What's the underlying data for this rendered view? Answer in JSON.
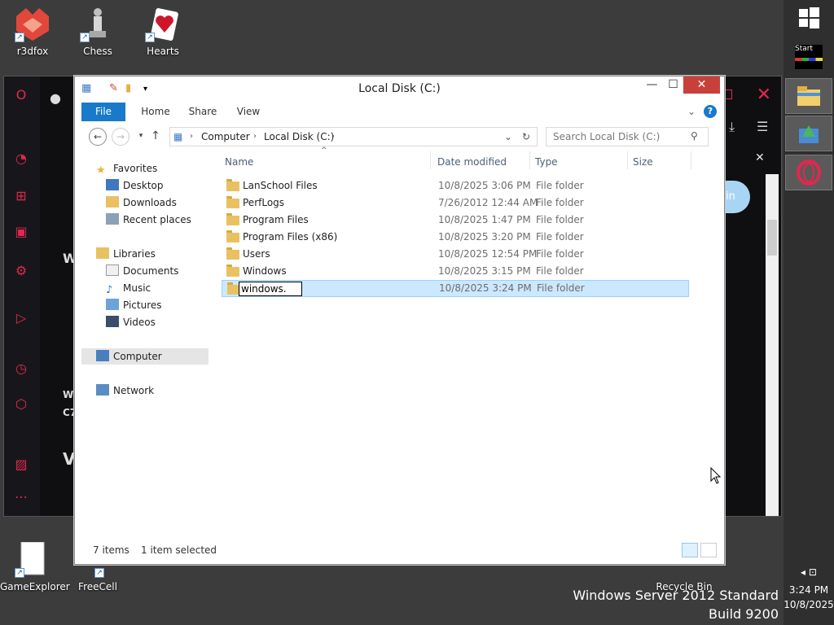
{
  "desktop": {
    "icons_top": [
      {
        "label": "r3dfox"
      },
      {
        "label": "Chess"
      },
      {
        "label": "Hearts"
      }
    ],
    "icons_bottom": [
      {
        "label": "GameExplorer"
      },
      {
        "label": "FreeCell"
      },
      {
        "label": "Recycle Bin"
      }
    ],
    "watermark": {
      "line1": "Windows Server 2012 Standard",
      "line2": "Build 9200"
    }
  },
  "taskbar": {
    "start_label": "Start",
    "clock_time": "3:24 PM",
    "clock_date": "10/8/2025"
  },
  "browser": {
    "partial_text": [
      "W",
      "Wi",
      "C7",
      "V",
      "in"
    ]
  },
  "explorer": {
    "title": "Local Disk (C:)",
    "ribbon_tabs": [
      "File",
      "Home",
      "Share",
      "View"
    ],
    "address_parts": [
      "Computer",
      "Local Disk (C:)"
    ],
    "search_placeholder": "Search Local Disk (C:)",
    "nav": {
      "favorites": "Favorites",
      "desktop": "Desktop",
      "downloads": "Downloads",
      "recent": "Recent places",
      "libraries": "Libraries",
      "documents": "Documents",
      "music": "Music",
      "pictures": "Pictures",
      "videos": "Videos",
      "computer": "Computer",
      "network": "Network"
    },
    "columns": {
      "name": "Name",
      "date": "Date modified",
      "type": "Type",
      "size": "Size"
    },
    "rows": [
      {
        "name": "LanSchool Files",
        "date": "10/8/2025 3:06 PM",
        "type": "File folder"
      },
      {
        "name": "PerfLogs",
        "date": "7/26/2012 12:44 AM",
        "type": "File folder"
      },
      {
        "name": "Program Files",
        "date": "10/8/2025 1:47 PM",
        "type": "File folder"
      },
      {
        "name": "Program Files (x86)",
        "date": "10/8/2025 3:20 PM",
        "type": "File folder"
      },
      {
        "name": "Users",
        "date": "10/8/2025 12:54 PM",
        "type": "File folder"
      },
      {
        "name": "Windows",
        "date": "10/8/2025 3:15 PM",
        "type": "File folder"
      },
      {
        "name": "windows.",
        "date": "10/8/2025 3:24 PM",
        "type": "File folder"
      }
    ],
    "status": {
      "items": "7 items",
      "selected": "1 item selected"
    }
  }
}
